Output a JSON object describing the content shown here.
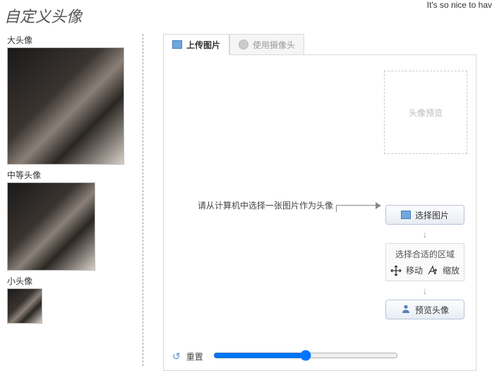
{
  "top_truncated": "It's so nice to hav",
  "page_title": "自定义头像",
  "left": {
    "large_label": "大头像",
    "medium_label": "中等头像",
    "small_label": "小头像"
  },
  "tabs": {
    "upload": "上传图片",
    "camera": "使用摄像头"
  },
  "panel": {
    "preview_placeholder": "头像预览",
    "instruction": "请从计算机中选择一张图片作为头像",
    "select_image_btn": "选择图片",
    "crop_hint_title": "选择合适的区域",
    "move_label": "移动",
    "zoom_label": "缩放",
    "preview_btn": "预览头像",
    "reset_label": "重置"
  }
}
